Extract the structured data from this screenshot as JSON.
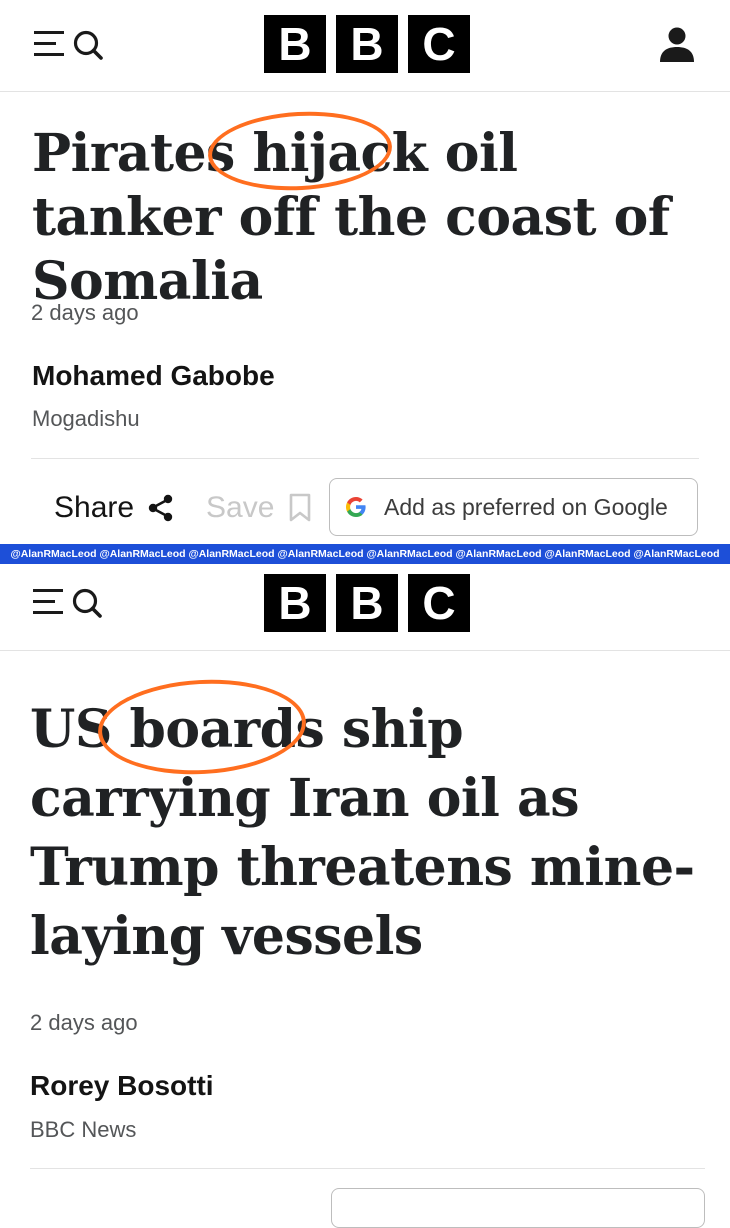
{
  "brand": {
    "logo_letters": [
      "B",
      "B",
      "C"
    ]
  },
  "colors": {
    "highlight_ring": "#ff6e1f",
    "watermark_bar": "#1d4fd8",
    "text": "#202224"
  },
  "icons": {
    "menu": "menu-lines-icon",
    "search": "search-icon",
    "user": "user-icon",
    "share": "share-icon",
    "save": "bookmark-icon",
    "google": "google-g-icon"
  },
  "article1": {
    "headline_before": "Pirates ",
    "headline_highlight": "hijack",
    "headline_after": " oil tanker off the coast of Somalia",
    "time": "2 days ago",
    "author": "Mohamed Gabobe",
    "location": "Mogadishu",
    "share_label": "Share",
    "save_label": "Save",
    "google_label": "Add as preferred on Google"
  },
  "watermark": "@AlanRMacLeod @AlanRMacLeod @AlanRMacLeod @AlanRMacLeod @AlanRMacLeod @AlanRMacLeod @AlanRMacLeod @AlanRMacLeod",
  "article2": {
    "headline_before": "US ",
    "headline_highlight": "boards",
    "headline_after": " ship carrying Iran oil as Trump threatens mine-laying vessels",
    "time": "2 days ago",
    "author": "Rorey Bosotti",
    "location": "BBC News"
  }
}
